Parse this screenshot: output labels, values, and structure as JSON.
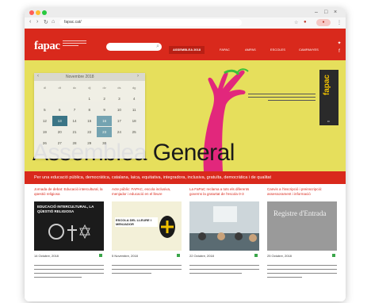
{
  "browser": {
    "url": "fapac.cat/",
    "window_controls": {
      "min": "–",
      "max": "□",
      "close": "×"
    }
  },
  "header": {
    "logo": "fapac",
    "nav": [
      {
        "label": "ASSEMBLEA 2018",
        "active": true
      },
      {
        "label": "FAPAC",
        "active": false
      },
      {
        "label": "AMPAS",
        "active": false
      },
      {
        "label": "ESCOLES",
        "active": false
      },
      {
        "label": "CAMPANYES",
        "active": false
      }
    ]
  },
  "banner": {
    "title": "Assemblea General",
    "badge": "fapac"
  },
  "calendar": {
    "month": "Novembre 2018",
    "prev": "‹",
    "next": "›",
    "weekdays": [
      "dl",
      "dt",
      "dc",
      "dj",
      "dv",
      "ds",
      "dg"
    ],
    "weeks": [
      [
        "",
        "",
        "",
        "1",
        "2",
        "3",
        "4"
      ],
      [
        "5",
        "6",
        "7",
        "8",
        "9",
        "10",
        "11"
      ],
      [
        "12",
        "13",
        "14",
        "15",
        "16",
        "17",
        "18"
      ],
      [
        "19",
        "20",
        "21",
        "22",
        "23",
        "24",
        "25"
      ],
      [
        "26",
        "27",
        "28",
        "29",
        "30",
        "",
        ""
      ]
    ]
  },
  "strip": {
    "text": "Per una educació pública, democràtica, catalana, laica, equitativa, integradora, inclusiva, gratuïta, democràtica i de qualitat"
  },
  "articles": [
    {
      "title": "Jornada de debat: Educació intercultural, la qüestió religiosa",
      "image_text": "EDUCACIÓ INTERCULTURAL, LA QÜESTIÓ RELIGIOSA",
      "date": "14 Octubre, 2018"
    },
    {
      "title": "Acte públic: FAPAC, escola inclusiva, menjador i educació en el lleure",
      "image_text": "ESCOLA DEL LLEURE I MENJADOR",
      "date": "5 Novembre, 2018"
    },
    {
      "title": "La FaPaC reclama a tots els diferents governs la gratuïtat de l'escola 0-3",
      "image_text": "",
      "date": "22 Octubre, 2018"
    },
    {
      "title": "Canvis a l'inscripció i preinscripció: assessorament i informació",
      "image_text": "Registre d'Entrada",
      "date": "25 Octubre, 2018"
    }
  ],
  "colors": {
    "brand_red": "#d9291c",
    "banner_yellow": "#e6df5c",
    "calendar_today": "#2f6d8a"
  }
}
